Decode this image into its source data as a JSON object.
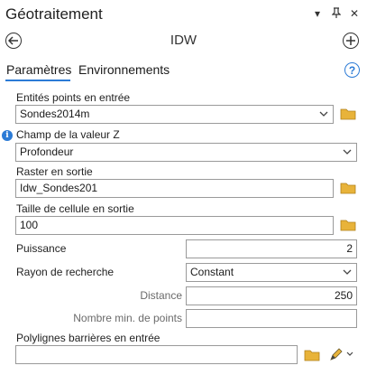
{
  "panel": {
    "title": "Géotraitement"
  },
  "window_controls": {
    "menu": "▾",
    "pin": "⊓",
    "close": "✕"
  },
  "tool": {
    "name": "IDW"
  },
  "tabs": [
    {
      "label": "Paramètres"
    },
    {
      "label": "Environnements"
    }
  ],
  "help_icon": "?",
  "params": {
    "input_points": {
      "label": "Entités points en entrée",
      "value": "Sondes2014m"
    },
    "z_field": {
      "label": "Champ de la valeur Z",
      "value": "Profondeur"
    },
    "output_raster": {
      "label": "Raster en sortie",
      "value": "Idw_Sondes201"
    },
    "cell_size": {
      "label": "Taille de cellule en sortie",
      "value": "100"
    },
    "power": {
      "label": "Puissance",
      "value": "2"
    },
    "search_radius": {
      "label": "Rayon de recherche",
      "value": "Constant"
    },
    "distance": {
      "label": "Distance",
      "value": "250"
    },
    "min_points": {
      "label": "Nombre min. de points",
      "value": ""
    },
    "barrier_polylines": {
      "label": "Polylignes barrières en entrée",
      "value": ""
    }
  },
  "colors": {
    "accent": "#2c7bd6",
    "folder": "#e8b33a"
  }
}
